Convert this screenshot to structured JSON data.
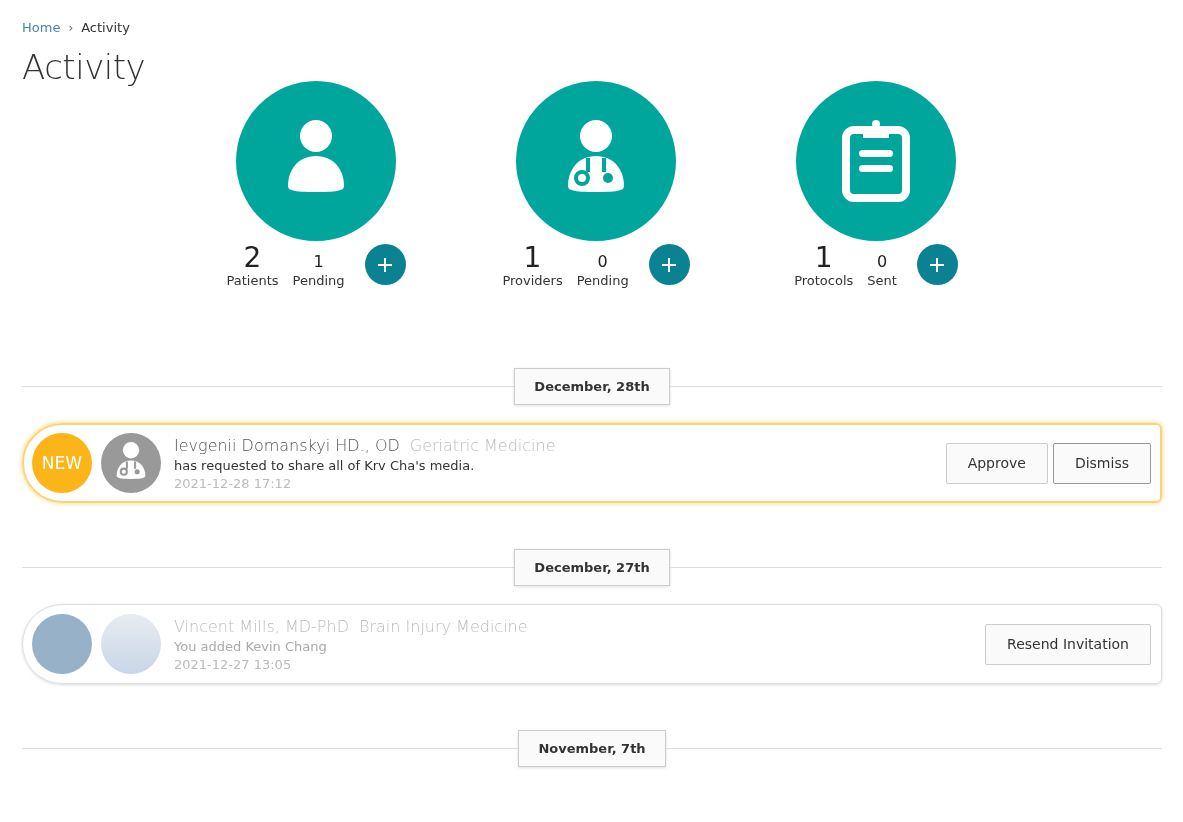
{
  "breadcrumb": [
    {
      "label": "Home",
      "link": true
    },
    {
      "label": "Activity",
      "link": false
    }
  ],
  "breadcrumb_separator": "›",
  "title": "Activity",
  "stats": [
    {
      "kind": "patient",
      "count": "2",
      "label": "Patients",
      "sub_count": "1",
      "sub_label": "Pending"
    },
    {
      "kind": "provider",
      "count": "1",
      "label": "Providers",
      "sub_count": "0",
      "sub_label": "Pending"
    },
    {
      "kind": "protocol",
      "count": "1",
      "label": "Protocols",
      "sub_count": "0",
      "sub_label": "Sent"
    }
  ],
  "groups": [
    {
      "date": "December, 28th",
      "items": [
        {
          "highlighted": true,
          "badge": {
            "text": "NEW",
            "color": "#fbb518"
          },
          "avatar": {
            "kind": "provider"
          },
          "name": "Ievgenii Domanskyi HD., OD",
          "specialty": "Geriatric Medicine",
          "message": "has requested to share all of Krv Cha's media.",
          "time": "2021-12-28 17:12",
          "dimmed": false,
          "buttons": [
            {
              "label": "Approve",
              "emphasis": false
            },
            {
              "label": "Dismiss",
              "emphasis": true
            }
          ]
        }
      ]
    },
    {
      "date": "December, 27th",
      "items": [
        {
          "highlighted": false,
          "badge": {
            "color": "#97b2c8"
          },
          "avatar": {
            "kind": "photo"
          },
          "name": "Vincent Mills, MD-PhD",
          "specialty": "Brain Injury Medicine",
          "message": "You added Kevin Chang",
          "time": "2021-12-27 13:05",
          "dimmed": true,
          "buttons": [
            {
              "label": "Resend Invitation",
              "emphasis": false
            }
          ]
        }
      ]
    },
    {
      "date": "November, 7th"
    }
  ]
}
